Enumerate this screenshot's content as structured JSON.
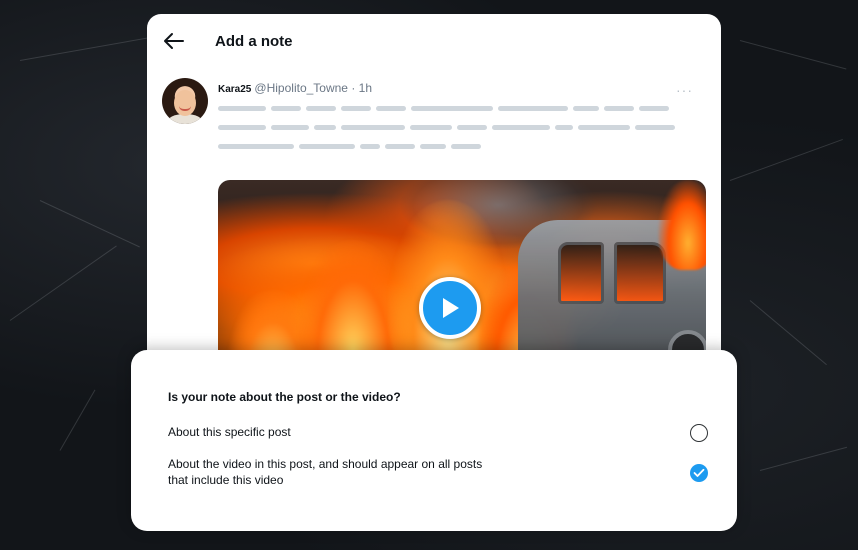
{
  "header": {
    "title": "Add a note",
    "back_icon": "arrow-left-icon"
  },
  "post": {
    "author_name": "Kara25",
    "author_handle": "@Hipolito_Towne · 1h",
    "more_icon": "ellipsis-icon",
    "media_icon": "play-icon"
  },
  "sheet": {
    "question": "Is your note about the post or the video?",
    "options": [
      {
        "label": "About this specific post",
        "selected": false
      },
      {
        "label": "About the video in this post, and should appear on all posts that include this video",
        "selected": true
      }
    ]
  },
  "colors": {
    "accent": "#1d9bf0",
    "background": "#121519"
  }
}
